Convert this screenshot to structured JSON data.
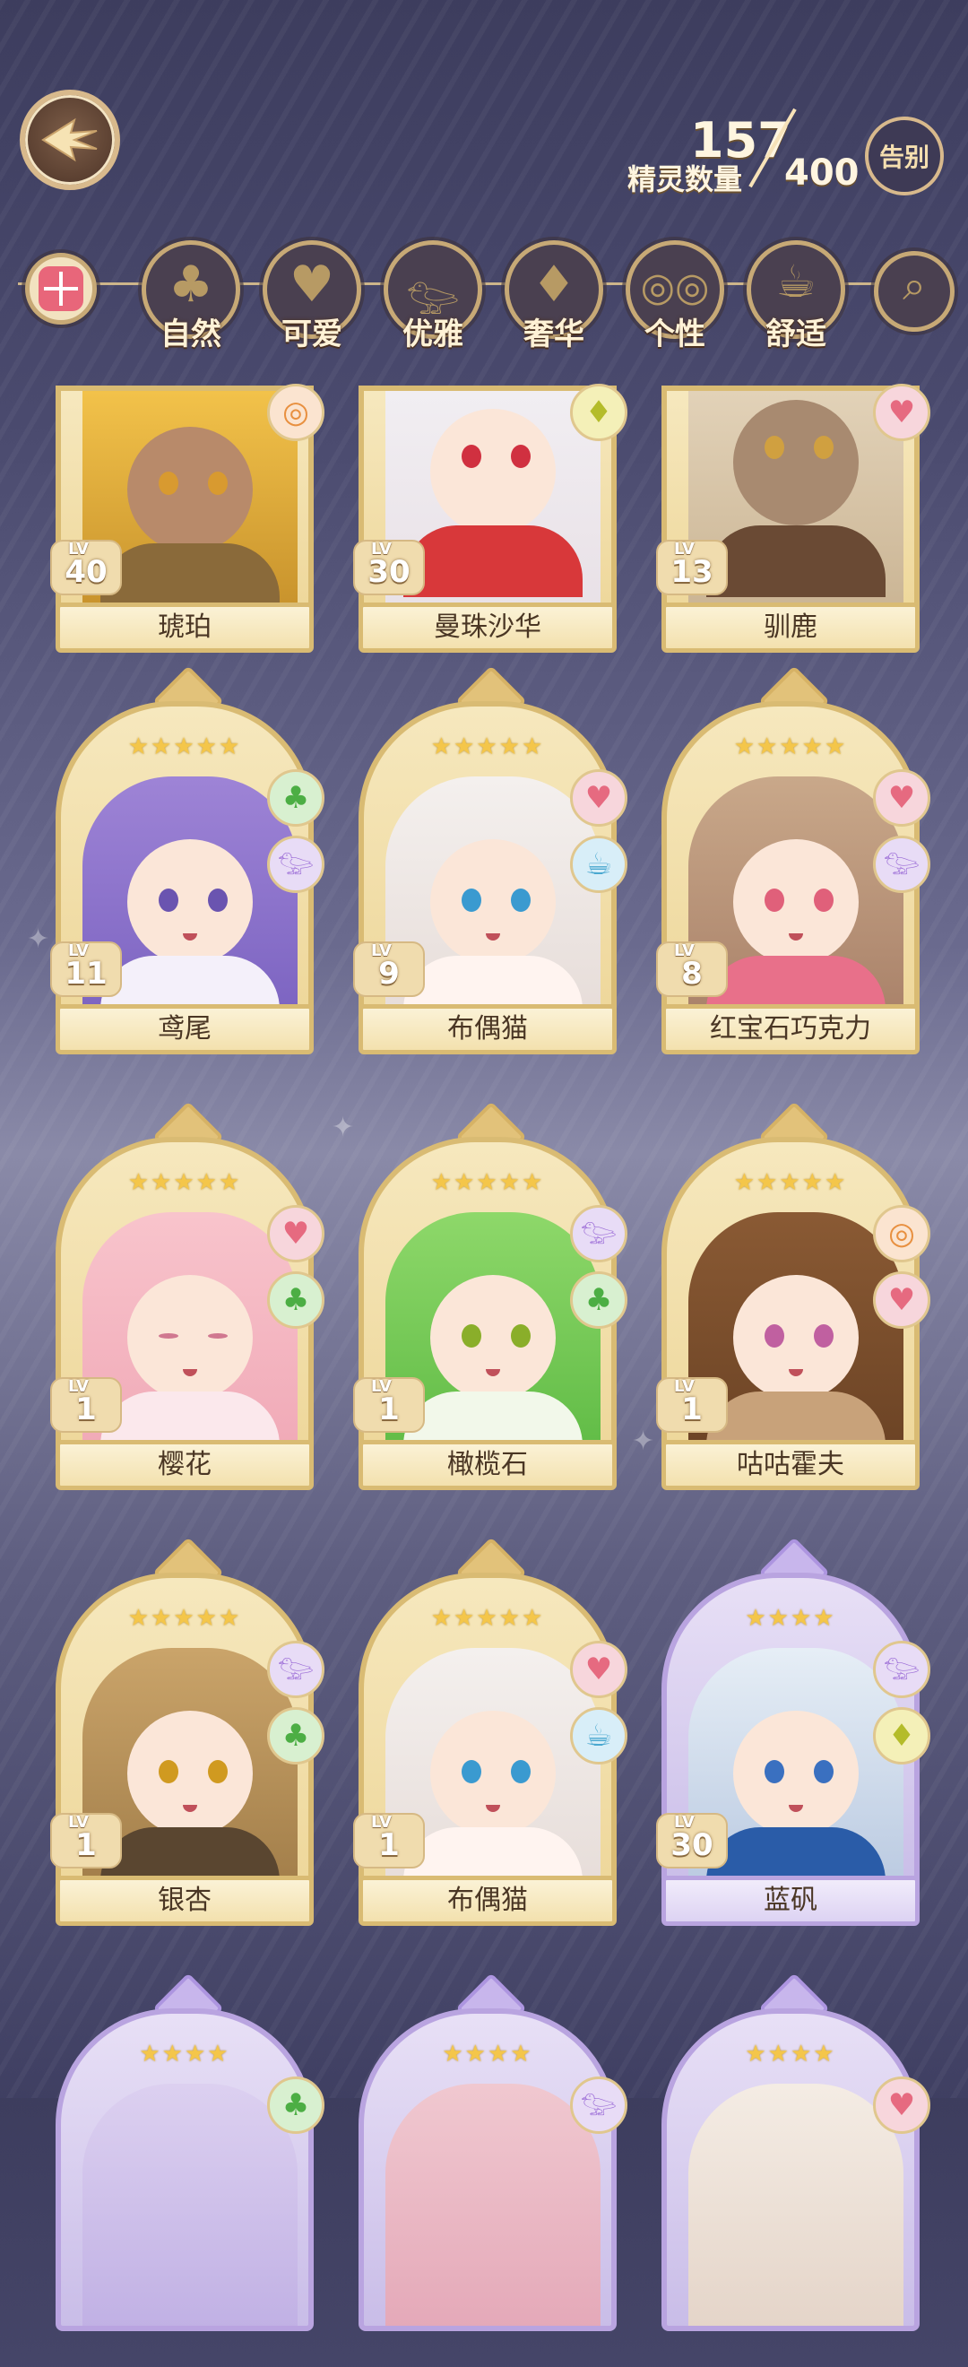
{
  "header": {
    "count_current": "157",
    "count_label": "精灵数量",
    "count_total": "400",
    "farewell_label": "告别"
  },
  "filters": [
    {
      "name": "全部",
      "label": "",
      "icon": "all-grid-icon"
    },
    {
      "label": "自然",
      "icon": "clover-icon"
    },
    {
      "label": "可爱",
      "icon": "heart-icon"
    },
    {
      "label": "优雅",
      "icon": "swan-icon"
    },
    {
      "label": "奢华",
      "icon": "diamond-icon"
    },
    {
      "label": "个性",
      "icon": "glasses-icon"
    },
    {
      "label": "舒适",
      "icon": "teacup-icon"
    }
  ],
  "cards": [
    {
      "name": "琥珀",
      "level": "40",
      "stars": "",
      "tags": [
        "spec"
      ]
    },
    {
      "name": "曼珠沙华",
      "level": "30",
      "stars": "",
      "tags": [
        "gem"
      ]
    },
    {
      "name": "驯鹿",
      "level": "13",
      "stars": "",
      "tags": [
        "heart"
      ]
    },
    {
      "name": "鸢尾",
      "level": "11",
      "stars": "★★★★★",
      "tags": [
        "clover",
        "swan"
      ]
    },
    {
      "name": "布偶猫",
      "level": "9",
      "stars": "★★★★★",
      "tags": [
        "heart",
        "tea"
      ]
    },
    {
      "name": "红宝石巧克力",
      "level": "8",
      "stars": "★★★★★",
      "tags": [
        "heart",
        "swan"
      ]
    },
    {
      "name": "樱花",
      "level": "1",
      "stars": "★★★★★",
      "tags": [
        "heart",
        "clover"
      ]
    },
    {
      "name": "橄榄石",
      "level": "1",
      "stars": "★★★★★",
      "tags": [
        "swan",
        "clover"
      ]
    },
    {
      "name": "咕咕霍夫",
      "level": "1",
      "stars": "★★★★★",
      "tags": [
        "spec",
        "heart"
      ]
    },
    {
      "name": "银杏",
      "level": "1",
      "stars": "★★★★★",
      "tags": [
        "swan",
        "clover"
      ]
    },
    {
      "name": "布偶猫",
      "level": "1",
      "stars": "★★★★★",
      "tags": [
        "heart",
        "tea"
      ]
    },
    {
      "name": "蓝矾",
      "level": "30",
      "stars": "★★★★",
      "tags": [
        "swan",
        "gem"
      ]
    },
    {
      "name": "",
      "level": "",
      "stars": "★★★★",
      "tags": [
        "clover"
      ]
    },
    {
      "name": "",
      "level": "",
      "stars": "★★★★",
      "tags": [
        "swan"
      ]
    },
    {
      "name": "",
      "level": "",
      "stars": "★★★★",
      "tags": [
        "heart"
      ]
    }
  ],
  "lv_label": "LV",
  "colors": {
    "gold_frame": "#d9bb73",
    "purple_frame": "#b9a4e0",
    "name_text": "#4a3624"
  }
}
